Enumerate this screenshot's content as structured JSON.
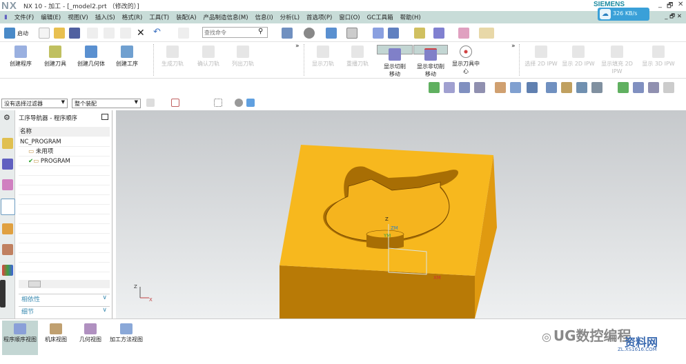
{
  "window": {
    "logo": "NX",
    "title": "NX 10 - 加工 - [_model2.prt （修改的）]",
    "brand": "SIEMENS",
    "net_speed": "326 KB/s",
    "minimize": "_",
    "restore": "🗗",
    "close": "✕"
  },
  "menu": [
    "文件(F)",
    "编辑(E)",
    "视图(V)",
    "插入(S)",
    "格式(R)",
    "工具(T)",
    "装配(A)",
    "产品制造信息(M)",
    "信息(I)",
    "分析(L)",
    "首选项(P)",
    "窗口(O)",
    "GC工具箱",
    "帮助(H)"
  ],
  "toolbar": {
    "start_label": "启动",
    "search_placeholder": "查找命令"
  },
  "ribbon": {
    "groups": [
      [
        {
          "label": "创建程序",
          "state": "enabled"
        },
        {
          "label": "创建刀具",
          "state": "enabled"
        },
        {
          "label": "创建几何体",
          "state": "enabled"
        },
        {
          "label": "创建工序",
          "state": "enabled"
        }
      ],
      [
        {
          "label": "生成刀轨",
          "state": "disabled"
        },
        {
          "label": "确认刀轨",
          "state": "disabled"
        },
        {
          "label": "列出刀轨",
          "state": "disabled"
        }
      ],
      [
        {
          "label": "显示刀轨",
          "state": "disabled"
        },
        {
          "label": "重播刀轨",
          "state": "disabled"
        },
        {
          "label": "显示切削移动",
          "state": "selected"
        },
        {
          "label": "显示非切削移动",
          "state": "selected"
        },
        {
          "label": "显示刀具中心",
          "state": "enabled"
        }
      ],
      [
        {
          "label": "选择 2D IPW",
          "state": "disabled"
        },
        {
          "label": "显示 2D IPW",
          "state": "disabled"
        },
        {
          "label": "显示填充 2D IPW",
          "state": "disabled"
        },
        {
          "label": "显示 3D IPW",
          "state": "disabled"
        }
      ]
    ],
    "more": "»"
  },
  "selection": {
    "filter": "没有选择过滤器",
    "scope": "整个装配"
  },
  "navigator": {
    "title": "工序导航器 - 程序顺序",
    "column": "名称",
    "items": [
      {
        "label": "NC_PROGRAM",
        "level": 0
      },
      {
        "label": "未用项",
        "level": 1
      },
      {
        "label": "PROGRAM",
        "level": 1,
        "status": "check"
      }
    ],
    "panels": [
      {
        "label": "相依性"
      },
      {
        "label": "细节"
      }
    ]
  },
  "viewport": {
    "colors": {
      "top": "#f7b81e",
      "front": "#b87a06",
      "side": "#e09a10",
      "bg": "#d6d9dc"
    },
    "axis_labels": {
      "z": "Z",
      "zm": "ZM",
      "ym": "YM",
      "xm": "XM",
      "x": "X"
    }
  },
  "bottom_tabs": [
    {
      "label": "程序顺序视图",
      "selected": true
    },
    {
      "label": "机床视图"
    },
    {
      "label": "几何视图"
    },
    {
      "label": "加工方法视图"
    }
  ],
  "watermark": {
    "text": "UG数控编程",
    "site": "资料网",
    "url": "ZL.XS1616.COM"
  }
}
